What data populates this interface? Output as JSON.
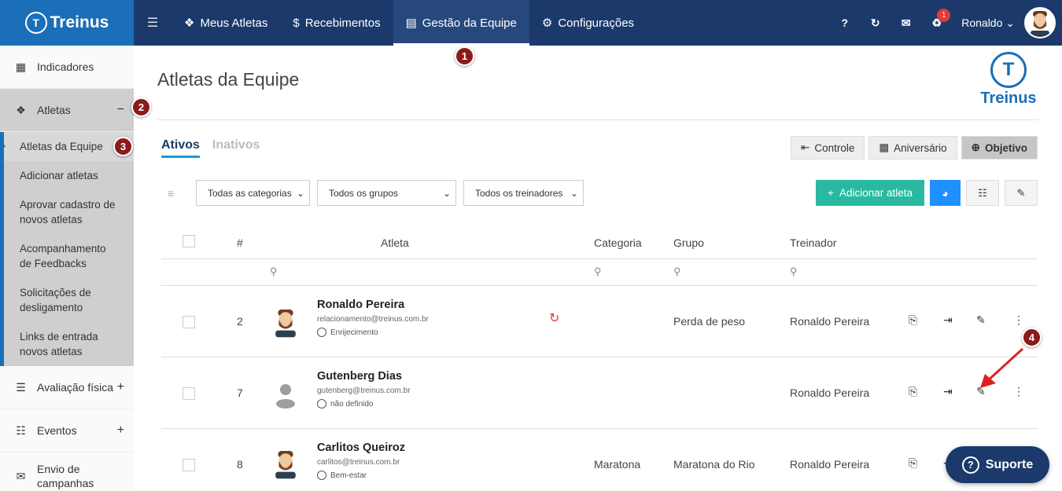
{
  "brand": {
    "name": "Treinus"
  },
  "topnav": {
    "items": [
      {
        "label": "Meus Atletas"
      },
      {
        "label": "Recebimentos"
      },
      {
        "label": "Gestão da Equipe"
      },
      {
        "label": "Configurações"
      }
    ],
    "active_index": 2,
    "help_label": "?",
    "notifications_count": "1",
    "user_name": "Ronaldo"
  },
  "sidebar": {
    "items": [
      {
        "label": "Indicadores",
        "icon": "bar-chart-icon"
      },
      {
        "label": "Atletas",
        "icon": "medal-icon",
        "toggle": "−"
      },
      {
        "label": "Avaliação física",
        "icon": "ruler-icon",
        "toggle": "+"
      },
      {
        "label": "Eventos",
        "icon": "calendar-icon",
        "toggle": "+"
      },
      {
        "label": "Envio de campanhas",
        "icon": "send-icon"
      }
    ],
    "subitems": [
      {
        "label": "Atletas da Equipe"
      },
      {
        "label": "Adicionar atletas"
      },
      {
        "label": "Aprovar cadastro de novos atletas"
      },
      {
        "label": "Acompanhamento de Feedbacks"
      },
      {
        "label": "Solicitações de desligamento"
      },
      {
        "label": "Links de entrada novos atletas"
      }
    ],
    "active_subitem": 0
  },
  "markers": [
    "1",
    "2",
    "3",
    "4"
  ],
  "page": {
    "title": "Atletas da Equipe",
    "tabs": [
      {
        "label": "Ativos"
      },
      {
        "label": "Inativos"
      }
    ],
    "active_tab": 0,
    "view_buttons": [
      {
        "label": "Controle"
      },
      {
        "label": "Aniversário"
      },
      {
        "label": "Objetivo"
      }
    ],
    "selected_view": 2,
    "filters": {
      "categoria": "Todas as categorias",
      "grupo": "Todos os grupos",
      "treinador": "Todos os treinadores"
    },
    "add_button": "Adicionar atleta"
  },
  "table": {
    "headers": {
      "num": "#",
      "atleta": "Atleta",
      "categoria": "Categoria",
      "grupo": "Grupo",
      "treinador": "Treinador"
    },
    "rows": [
      {
        "num": "2",
        "name": "Ronaldo Pereira",
        "email": "relacionamento@treinus.com.br",
        "goal": "Enrijecimento",
        "categoria": "",
        "grupo": "Perda de peso",
        "treinador": "Ronaldo Pereira",
        "avatar": "bearded-man",
        "refresh": true
      },
      {
        "num": "7",
        "name": "Gutenberg Dias",
        "email": "gutenberg@treinus.com.br",
        "goal": "não definido",
        "categoria": "",
        "grupo": "",
        "treinador": "Ronaldo Pereira",
        "avatar": "default-user",
        "refresh": false
      },
      {
        "num": "8",
        "name": "Carlitos Queiroz",
        "email": "carlitos@treinus.com.br",
        "goal": "Bem-estar",
        "categoria": "Maratona",
        "grupo": "Maratona do Rio",
        "treinador": "Ronaldo Pereira",
        "avatar": "bearded-man",
        "refresh": false
      }
    ]
  },
  "support": {
    "label": "Suporte"
  },
  "colors": {
    "topbar": "#1b3a6b",
    "logo_bg": "#1a6fb8",
    "add": "#29b9a0",
    "marker": "#8b1a1a",
    "accent": "#1a9ad6"
  }
}
